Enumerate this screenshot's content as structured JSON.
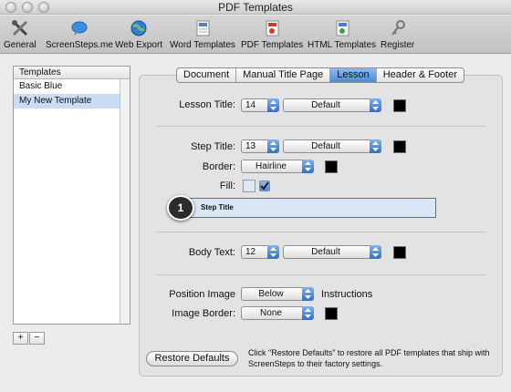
{
  "window": {
    "title": "PDF Templates"
  },
  "toolbar": {
    "items": [
      {
        "label": "General",
        "icon": "tools-icon"
      },
      {
        "label": "ScreenSteps.me",
        "icon": "chat-bubble-icon"
      },
      {
        "label": "Web Export",
        "icon": "globe-icon"
      },
      {
        "label": "Word Templates",
        "icon": "word-doc-icon"
      },
      {
        "label": "PDF Templates",
        "icon": "pdf-doc-icon"
      },
      {
        "label": "HTML Templates",
        "icon": "html-doc-icon"
      },
      {
        "label": "Register",
        "icon": "key-icon"
      }
    ]
  },
  "templates": {
    "header": "Templates",
    "items": [
      "Basic Blue",
      "My New Template"
    ],
    "selected": "My New Template",
    "add_label": "+",
    "remove_label": "−"
  },
  "tabs": [
    "Document",
    "Manual Title Page",
    "Lesson",
    "Header & Footer"
  ],
  "active_tab": "Lesson",
  "lesson_title": {
    "label": "Lesson Title:",
    "size": "14",
    "font": "Default",
    "color": "#000000"
  },
  "step_title": {
    "label": "Step Title:",
    "size": "13",
    "font": "Default",
    "color": "#000000",
    "border_label": "Border:",
    "border": "Hairline",
    "border_color": "#000000",
    "fill_label": "Fill:",
    "fill_color": "#dbe8f6",
    "fill_checked": true,
    "preview_text": "Step Title",
    "callout": "1"
  },
  "body_text": {
    "label": "Body Text:",
    "size": "12",
    "font": "Default",
    "color": "#000000"
  },
  "position_image": {
    "label": "Position Image",
    "value": "Below",
    "suffix": "Instructions"
  },
  "image_border": {
    "label": "Image Border:",
    "value": "None",
    "color": "#000000"
  },
  "restore": {
    "button_label": "Restore Defaults",
    "note": "Click \"Restore Defaults\" to restore all PDF templates that ship with ScreenSteps to their factory settings."
  }
}
